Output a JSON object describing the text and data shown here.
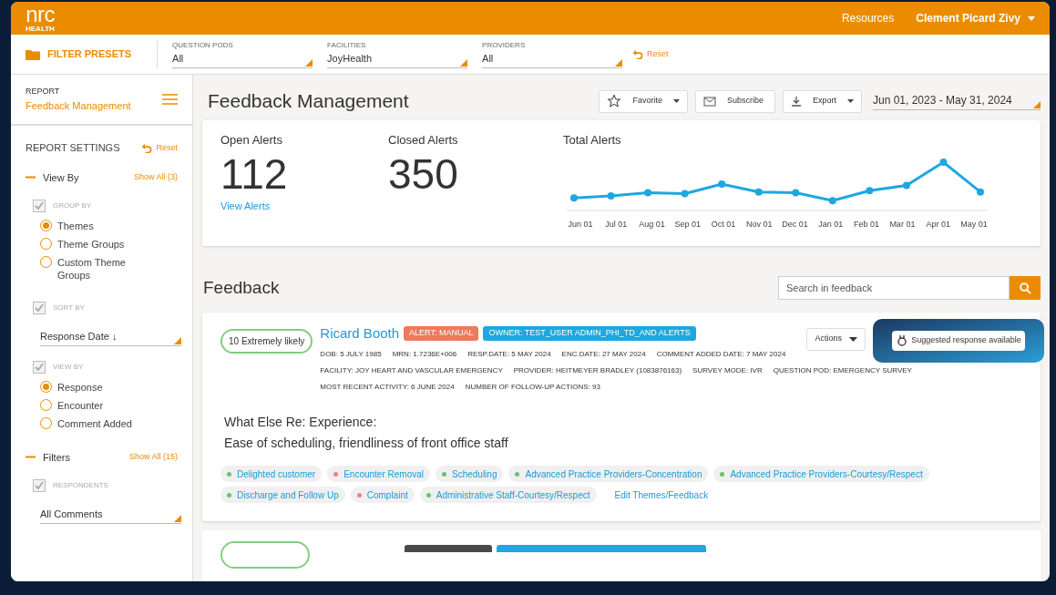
{
  "header": {
    "logo": "nrc",
    "logo_sub": "HEALTH",
    "links": [
      "Resources"
    ],
    "user": "Clement Picard Zivy"
  },
  "filter_bar": {
    "presets": "FILTER PRESETS",
    "filters": [
      {
        "label": "QUESTION PODS",
        "value": "All"
      },
      {
        "label": "FACILITIES",
        "value": "JoyHealth"
      },
      {
        "label": "PROVIDERS",
        "value": "All"
      }
    ],
    "reset": "Reset"
  },
  "sidebar": {
    "report_label": "REPORT",
    "report_name": "Feedback Management",
    "settings_title": "REPORT SETTINGS",
    "reset": "Reset",
    "sections": [
      {
        "title": "View By",
        "expanded": true,
        "show_all": "Show All (3)",
        "groups": [
          {
            "kind": "radio",
            "label": "GROUP BY",
            "checked": true,
            "options": [
              {
                "label": "Themes",
                "selected": true
              },
              {
                "label": "Theme Groups",
                "selected": false
              },
              {
                "label": "Custom Theme Groups",
                "selected": false
              }
            ]
          },
          {
            "kind": "select",
            "label": "SORT BY",
            "checked": true,
            "value": "Response Date ↓"
          },
          {
            "kind": "radio",
            "label": "VIEW BY",
            "checked": true,
            "options": [
              {
                "label": "Response",
                "selected": true
              },
              {
                "label": "Encounter",
                "selected": false
              },
              {
                "label": "Comment Added",
                "selected": false
              }
            ]
          }
        ]
      },
      {
        "title": "Filters",
        "expanded": true,
        "show_all": "Show All (15)",
        "groups": [
          {
            "kind": "select",
            "label": "RESPONDENTS",
            "checked": true,
            "value": "All Comments"
          }
        ]
      }
    ]
  },
  "page": {
    "title": "Feedback Management",
    "buttons": [
      {
        "label": "Favorite",
        "menu": true
      },
      {
        "label": "Subscribe",
        "menu": false
      },
      {
        "label": "Export",
        "menu": true
      }
    ],
    "date_range": "Jun 01, 2023 - May 31, 2024"
  },
  "summary": {
    "stats": [
      {
        "label": "Open Alerts",
        "value": "112",
        "link": "View Alerts"
      },
      {
        "label": "Closed Alerts",
        "value": "350"
      }
    ],
    "trend": {
      "title": "Total Alerts",
      "x_labels": [
        "Jun 01",
        "Jul 01",
        "Aug 01",
        "Sep 01",
        "Oct 01",
        "Nov 01",
        "Dec 01",
        "Jan 01",
        "Feb 01",
        "Mar 01",
        "Apr 01",
        "May 01"
      ]
    }
  },
  "feedback": {
    "title": "Feedback",
    "search": {
      "placeholder": "Search in feedback"
    },
    "cards": [
      {
        "score": "10 Extremely likely",
        "name": "Ricard Booth",
        "badges": [
          {
            "text": "ALERT: MANUAL",
            "color": "#ec7a5c"
          },
          {
            "text": "OWNER: TEST_USER ADMIN_PHI_TD_AND ALERTS",
            "color": "#1ea7e0"
          }
        ],
        "meta": [
          [
            "DOB: 5 JULY 1985",
            "MRN: 1.7236E+006",
            "RESP.DATE: 5 MAY 2024",
            "ENC.DATE: 27 MAY 2024",
            "COMMENT ADDED DATE: 7 MAY 2024"
          ],
          [
            "FACILITY: JOY HEART AND VASCULAR EMERGENCY",
            "PROVIDER: HEITMEYER BRADLEY (1083876163)",
            "SURVEY MODE: IVR",
            "QUESTION POD: EMERGENCY SURVEY"
          ],
          [
            "MOST RECENT ACTIVITY: 6 JUNE 2024",
            "NUMBER OF FOLLOW-UP ACTIONS: 93"
          ]
        ],
        "actions": "Actions",
        "suggestion": "Suggested response available",
        "question": "What Else Re: Experience:",
        "answer": "Ease of scheduling, friendliness of front office staff",
        "themes": [
          {
            "label": "Delighted customer",
            "color": "#6cc070"
          },
          {
            "label": "Encounter Removal",
            "color": "#f08080"
          },
          {
            "label": "Scheduling",
            "color": "#6cc070"
          },
          {
            "label": "Advanced Practice Providers-Concentration",
            "color": "#6cc070"
          },
          {
            "label": "Advanced Practice Providers-Courtesy/Respect",
            "color": "#6cc070"
          },
          {
            "label": "Discharge and Follow Up",
            "color": "#6cc070"
          },
          {
            "label": "Complaint",
            "color": "#f08080"
          },
          {
            "label": "Administrative Staff-Courtesy/Respect",
            "color": "#6cc070"
          }
        ],
        "edit": "Edit Themes/Feedback"
      },
      {
        "kind": "cut_off",
        "badges": [
          {
            "color": "#4a4a4a"
          },
          {
            "color": "#1ea7e0"
          }
        ]
      }
    ]
  }
}
